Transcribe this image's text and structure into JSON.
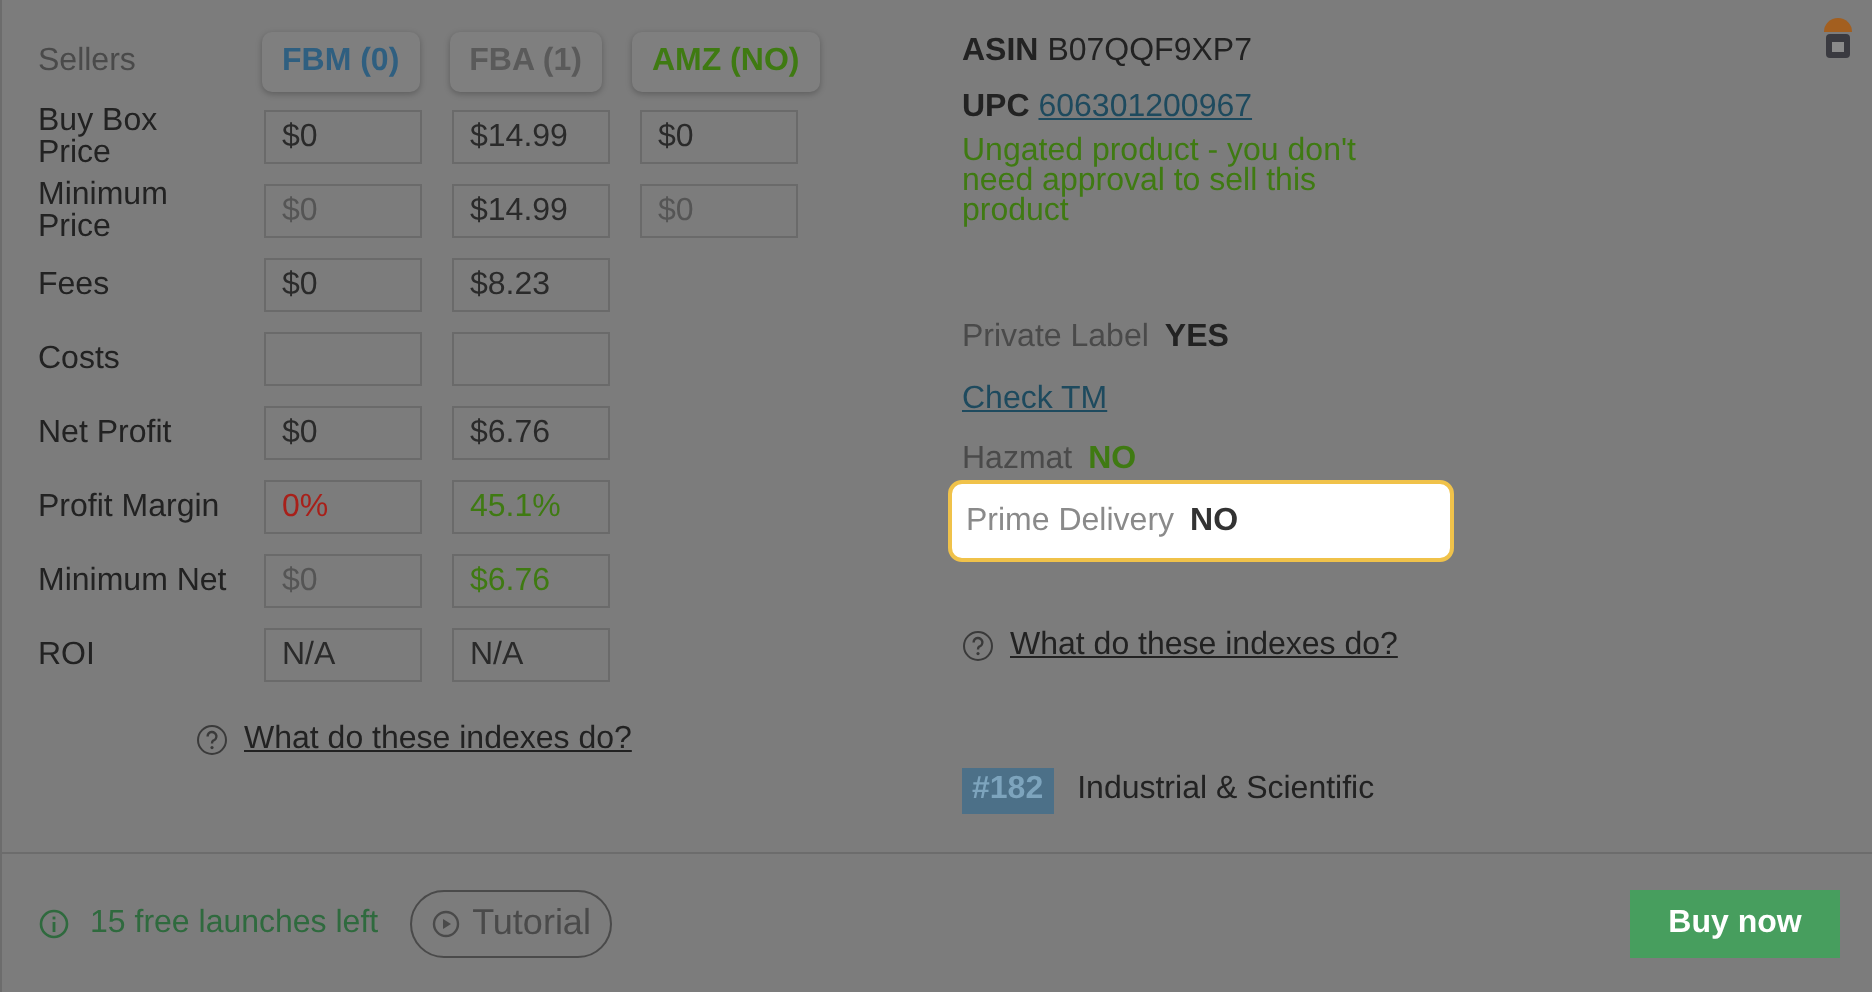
{
  "sellers": {
    "label": "Sellers",
    "tabs": [
      {
        "label": "FBM (0)",
        "color": "#2f5f80"
      },
      {
        "label": "FBA (1)",
        "color": "#5a5a5a"
      },
      {
        "label": "AMZ (NO)",
        "color": "#3f7a12"
      }
    ]
  },
  "rows": [
    {
      "label": "Buy Box Price",
      "cells": [
        {
          "value": "$0",
          "kind": "normal"
        },
        {
          "value": "$14.99",
          "kind": "normal"
        },
        {
          "value": "$0",
          "kind": "normal"
        }
      ]
    },
    {
      "label": "Minimum Price",
      "cells": [
        {
          "value": "$0",
          "kind": "muted"
        },
        {
          "value": "$14.99",
          "kind": "normal"
        },
        {
          "value": "$0",
          "kind": "muted"
        }
      ]
    },
    {
      "label": "Fees",
      "cells": [
        {
          "value": "$0",
          "kind": "normal"
        },
        {
          "value": "$8.23",
          "kind": "normal"
        }
      ]
    },
    {
      "label": "Costs",
      "cells": [
        {
          "kind": "normal"
        },
        {
          "kind": "normal"
        }
      ]
    },
    {
      "label": "Net Profit",
      "cells": [
        {
          "value": "$0",
          "kind": "normal"
        },
        {
          "value": "$6.76",
          "kind": "normal"
        }
      ]
    },
    {
      "label": "Profit Margin",
      "cells": [
        {
          "value": "0%",
          "kind": "negative"
        },
        {
          "value": "45.1%",
          "kind": "positive"
        }
      ]
    },
    {
      "label": "Minimum Net",
      "cells": [
        {
          "value": "$0",
          "kind": "muted"
        },
        {
          "value": "$6.76",
          "kind": "positive"
        }
      ]
    },
    {
      "label": "ROI",
      "cells": [
        {
          "value": "N/A",
          "kind": "normal"
        },
        {
          "value": "N/A",
          "kind": "normal"
        }
      ]
    }
  ],
  "left_help_link": "What do these indexes do?",
  "asin": {
    "label": "ASIN",
    "value": "B07QQF9XP7"
  },
  "upc": {
    "label": "UPC",
    "value": "606301200967"
  },
  "gating_message": "Ungated product - you don't need approval to sell this product",
  "private_label": {
    "label": "Private Label",
    "value": "YES"
  },
  "check_tm_link": "Check TM",
  "hazmat": {
    "label": "Hazmat",
    "value": "NO"
  },
  "prime_delivery": {
    "label": "Prime Delivery",
    "value": "NO",
    "highlighted": true
  },
  "right_help_link": "What do these indexes do?",
  "rank": {
    "badge": "#182",
    "category": "Industrial & Scientific"
  },
  "footer": {
    "launches": "15 free launches left",
    "tutorial_button": "Tutorial",
    "buy_button": "Buy now"
  }
}
